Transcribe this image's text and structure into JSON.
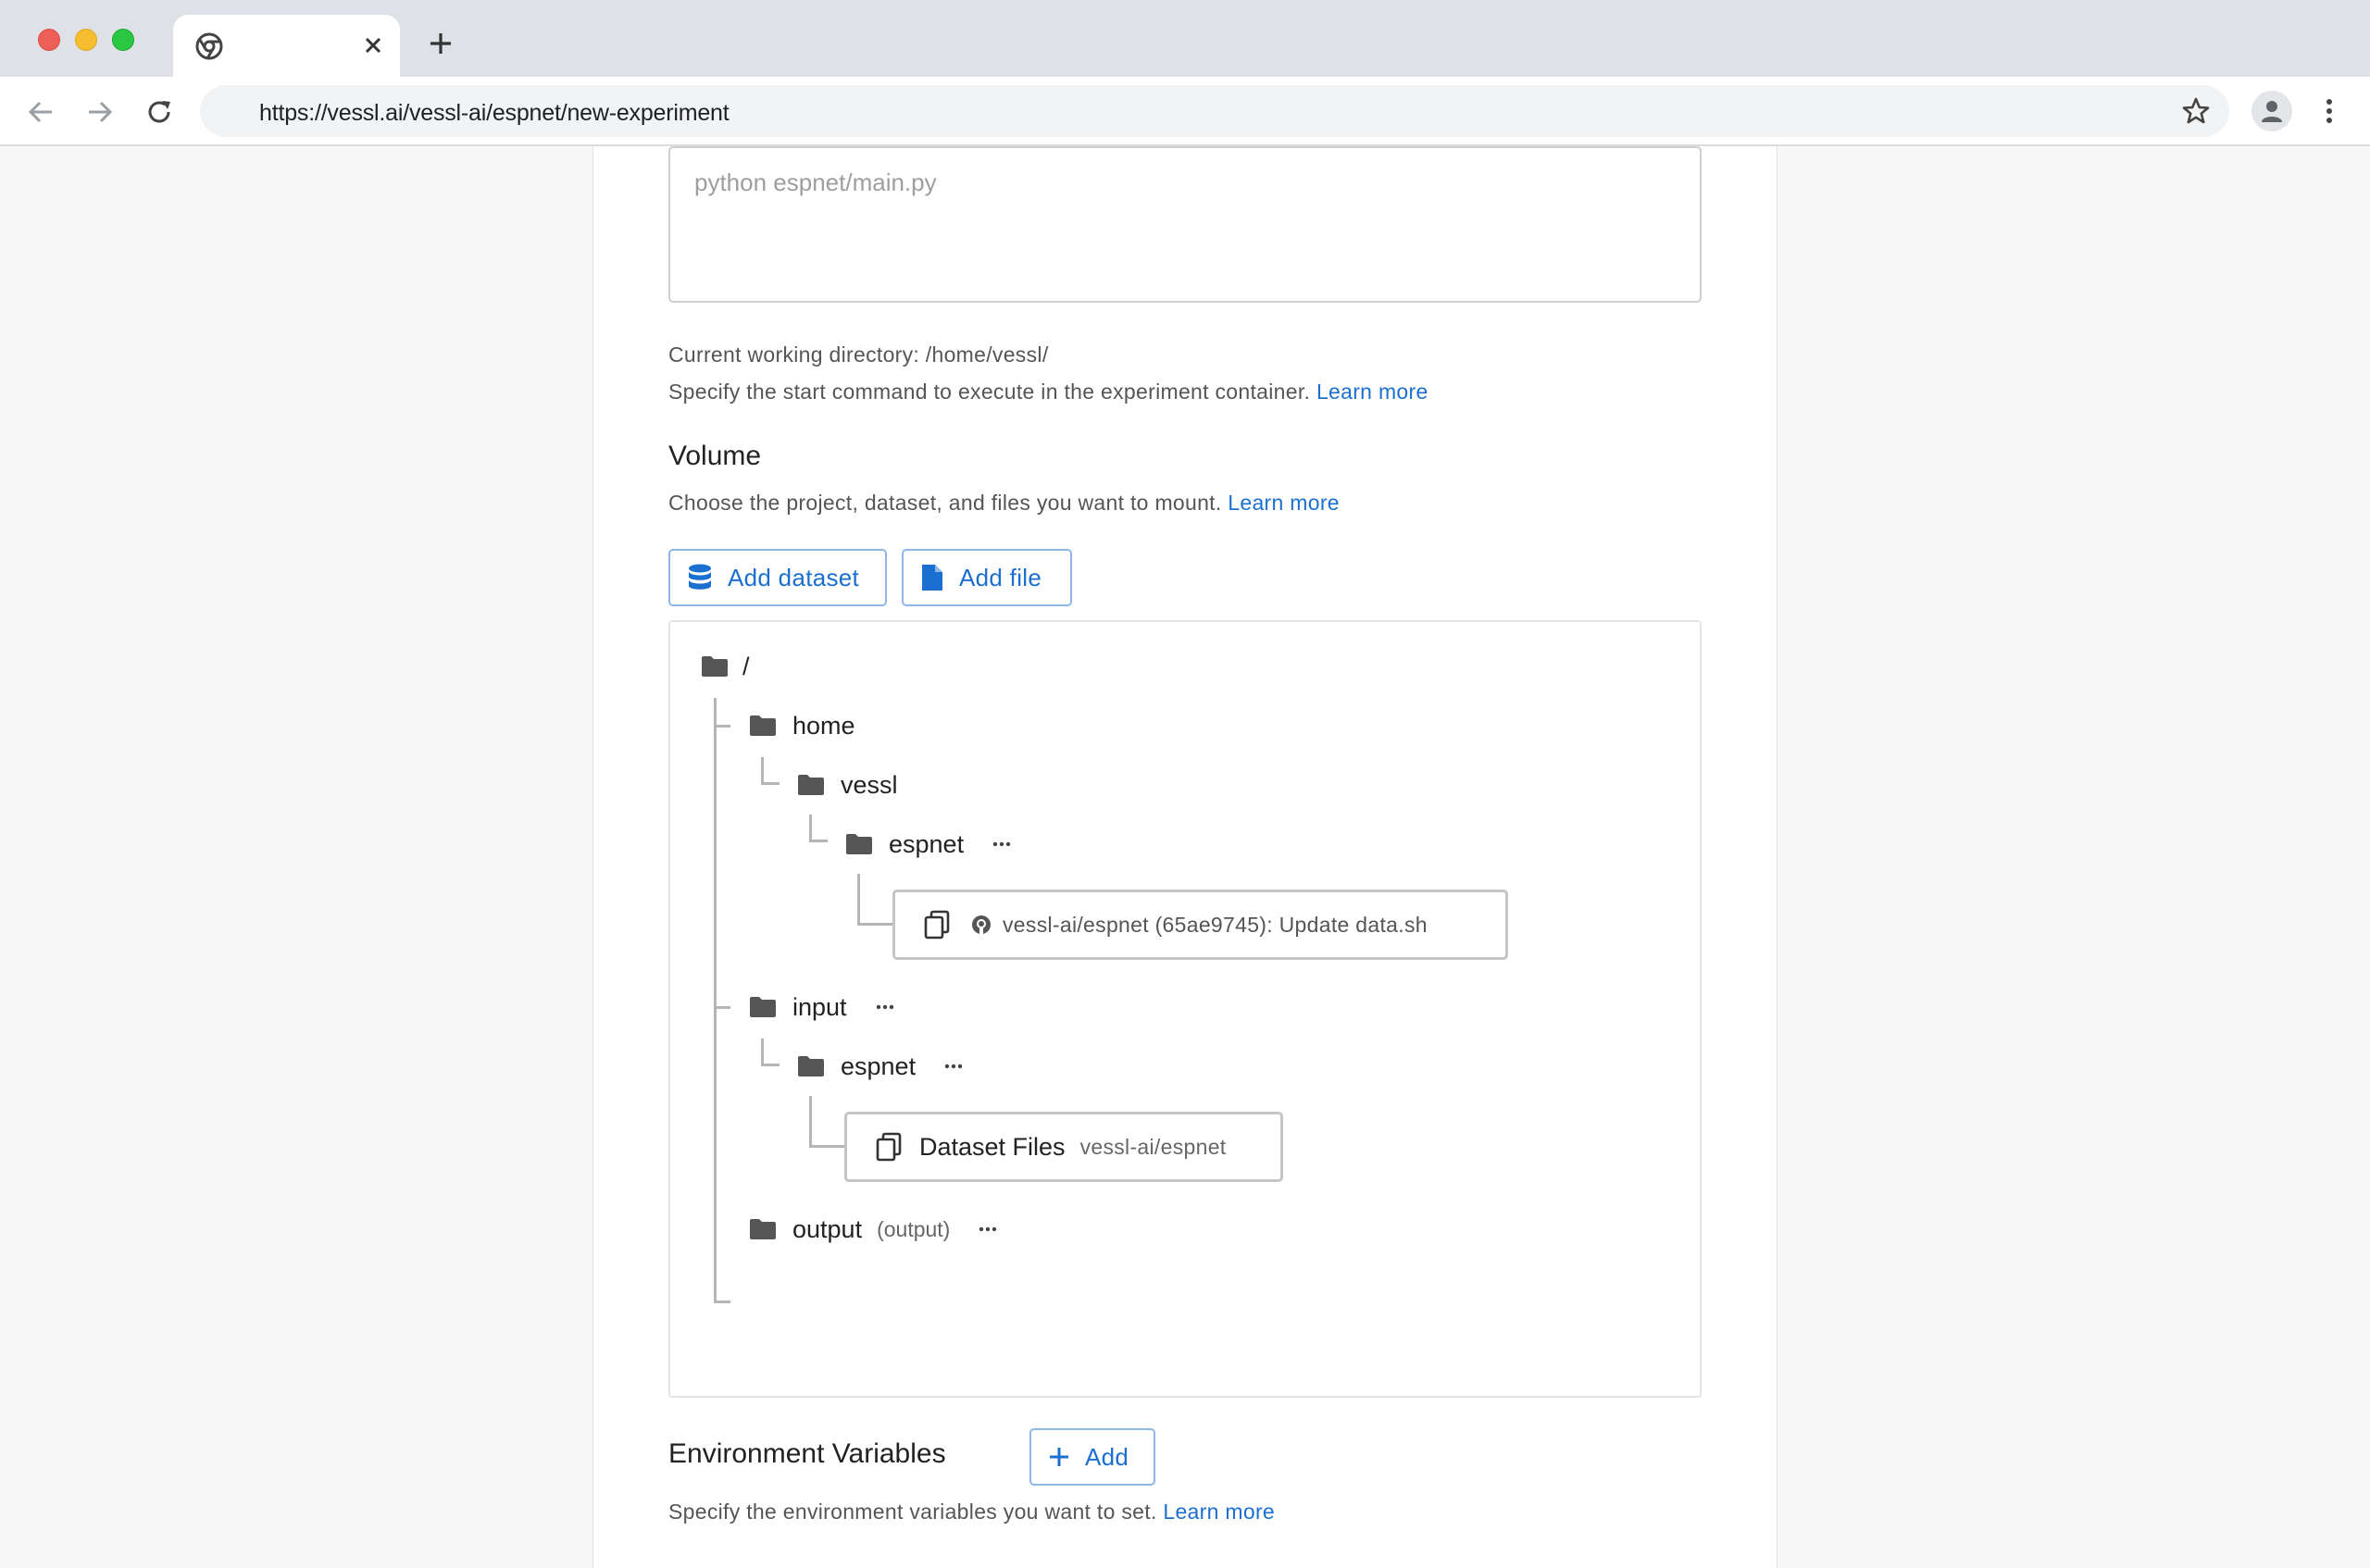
{
  "browser": {
    "url": "https://vessl.ai/vessl-ai/espnet/new-experiment"
  },
  "command": {
    "placeholder": "python espnet/main.py",
    "cwd_text": "Current working directory: /home/vessl/",
    "help_text": "Specify the start command to execute in the experiment container.",
    "learn_more": "Learn more"
  },
  "volume": {
    "title": "Volume",
    "help_text": "Choose the project, dataset, and files you want to mount.",
    "learn_more": "Learn more",
    "add_dataset": "Add dataset",
    "add_file": "Add file",
    "tree": {
      "root": "/",
      "home": "home",
      "vessl": "vessl",
      "espnet_code": "espnet",
      "github_mount": "vessl-ai/espnet (65ae9745): Update data.sh",
      "input": "input",
      "espnet_input": "espnet",
      "dataset_title": "Dataset Files",
      "dataset_sub": "vessl-ai/espnet",
      "output": "output",
      "output_tag": "(output)"
    }
  },
  "env": {
    "title": "Environment Variables",
    "add": "Add",
    "help_text": "Specify the environment variables you want to set.",
    "learn_more": "Learn more"
  },
  "colors": {
    "link": "#1a6fd1",
    "button_border": "#8fb7e6",
    "tree_line": "#b5b5b5",
    "folder": "#555555"
  }
}
